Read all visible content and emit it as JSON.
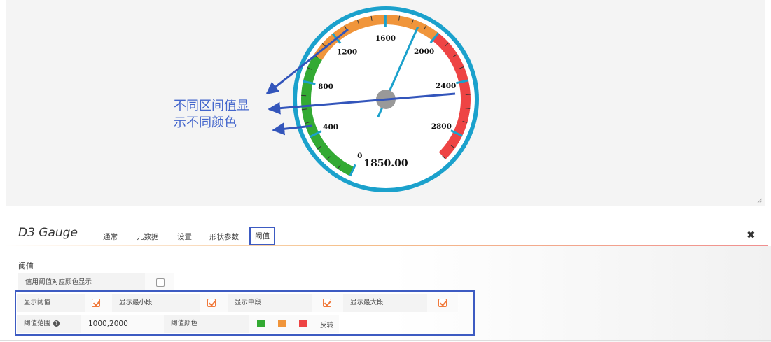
{
  "gauge": {
    "min": 0,
    "max": 3000,
    "value": 1850.0,
    "value_text": "1850.00",
    "major_labels": [
      "0",
      "400",
      "800",
      "1200",
      "1600",
      "2000",
      "2400",
      "2800"
    ],
    "thresholds": [
      1000,
      2000
    ],
    "colors": {
      "low": "#33aa33",
      "mid": "#f0953b",
      "high": "#ee4444",
      "ring": "#1ba1cc",
      "needle": "#1ba1cc"
    }
  },
  "annotation": {
    "line1": "不同区间值显",
    "line2": "示不同颜色",
    "color": "#4466cc"
  },
  "panel": {
    "title": "D3 Gauge",
    "tabs": [
      "通常",
      "元数据",
      "设置",
      "形状参数",
      "阈值"
    ],
    "active_tab": "阈值",
    "section_label": "阈值",
    "use_threshold_color_label": "信用阈值对应颜色显示",
    "use_threshold_color_checked": false,
    "row1": [
      {
        "label": "显示阈值",
        "checked": true
      },
      {
        "label": "显示最小段",
        "checked": true
      },
      {
        "label": "显示中段",
        "checked": true
      },
      {
        "label": "显示最大段",
        "checked": true
      }
    ],
    "range_label": "阈值范围",
    "range_value": "1000,2000",
    "color_label": "阈值颜色",
    "swatches": [
      "#33aa33",
      "#f0953b",
      "#ee4444"
    ],
    "reverse_label": "反转"
  }
}
